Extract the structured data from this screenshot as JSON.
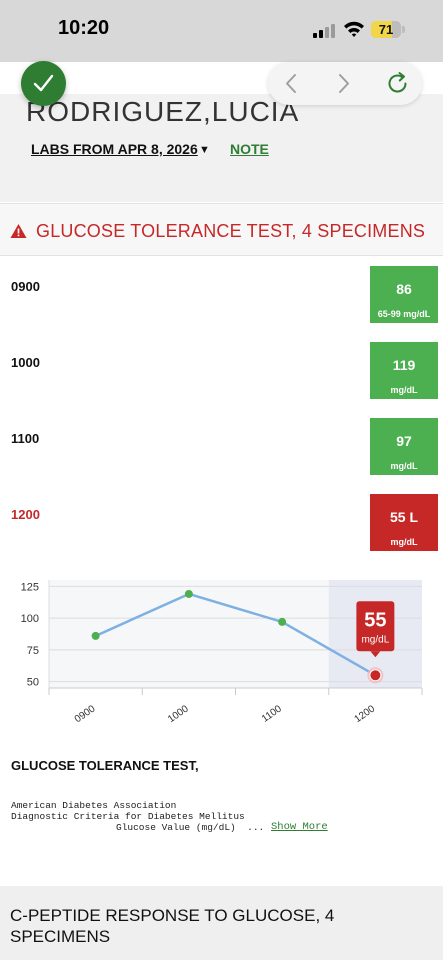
{
  "status_bar": {
    "time": "10:20",
    "battery": "71",
    "battery_level": 0.71
  },
  "header": {
    "patient_name": "RODRIGUEZ,LUCIA",
    "labs_from_label": "LABS FROM APR 8, 2026",
    "note_label": "NOTE"
  },
  "alert": {
    "title": "GLUCOSE TOLERANCE TEST, 4 SPECIMENS"
  },
  "results": [
    {
      "time": "0900",
      "value": "86",
      "range": "65-99 mg/dL",
      "status": "normal"
    },
    {
      "time": "1000",
      "value": "119",
      "range": "mg/dL",
      "status": "normal"
    },
    {
      "time": "1100",
      "value": "97",
      "range": "mg/dL",
      "status": "normal"
    },
    {
      "time": "1200",
      "value": "55 L",
      "range": "mg/dL",
      "status": "low"
    }
  ],
  "chart_data": {
    "type": "line",
    "categories": [
      "0900",
      "1000",
      "1100",
      "1200"
    ],
    "series": [
      {
        "values": [
          86,
          119,
          97,
          55
        ]
      }
    ],
    "y_ticks": [
      "125",
      "100",
      "75",
      "50"
    ],
    "ylim": [
      45,
      130
    ],
    "grid": true,
    "highlight": {
      "value": "55",
      "unit": "mg/dL"
    }
  },
  "description": {
    "title": "GLUCOSE TOLERANCE TEST,",
    "line1": "American Diabetes Association",
    "line2": "Diagnostic Criteria for Diabetes Mellitus",
    "line3": "Glucose Value (mg/dL)  ...",
    "show_more": "Show More"
  },
  "next_section": {
    "title": "C-PEPTIDE RESPONSE TO GLUCOSE, 4 SPECIMENS"
  },
  "colors": {
    "normal": "#4caf50",
    "low": "#c62828",
    "accent": "#2e7d32",
    "line": "#7eb0e2"
  }
}
